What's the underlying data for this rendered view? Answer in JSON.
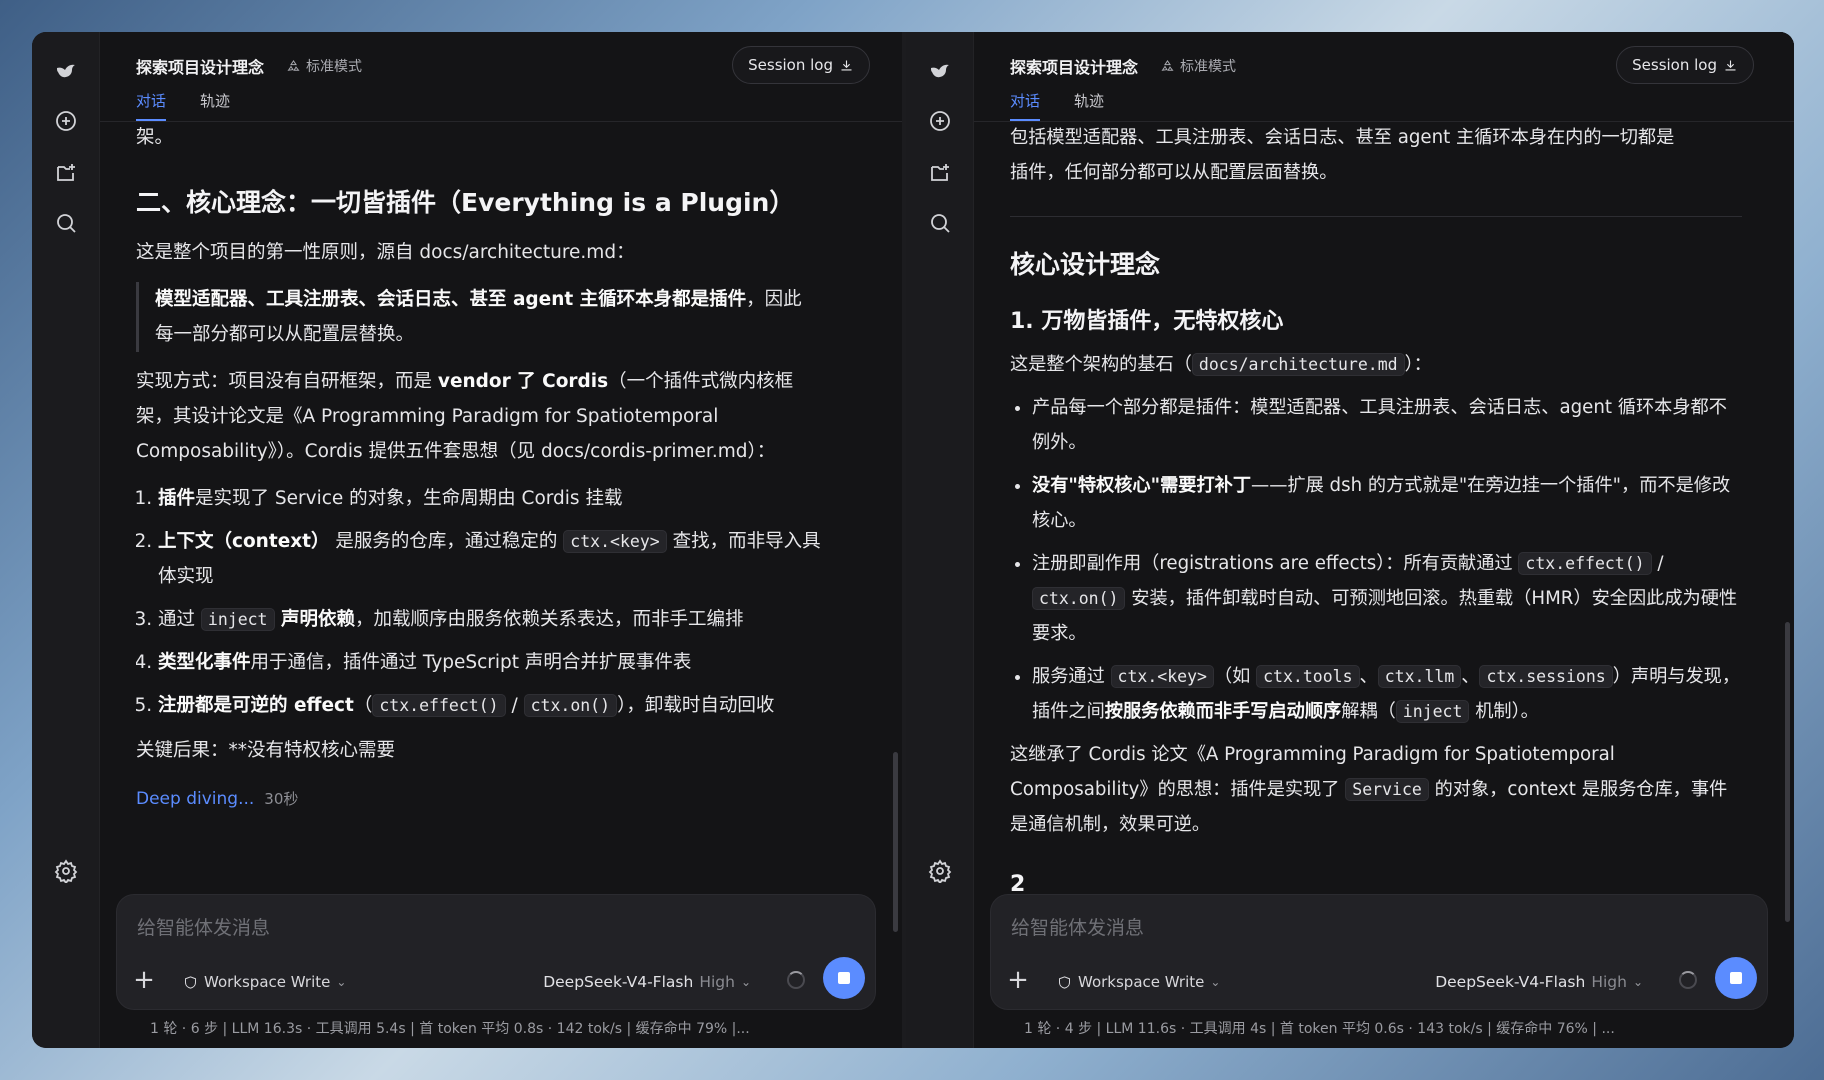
{
  "left": {
    "title": "探索项目设计理念",
    "mode": "标准模式",
    "session_log": "Session log",
    "tabs": [
      "对话",
      "轨迹"
    ],
    "content": {
      "frag": "架。",
      "h2": "二、核心理念：一切皆插件（Everything is a Plugin）",
      "p1": "这是整个项目的第一性原则，源自 docs/architecture.md：",
      "quote_bold": "模型适配器、工具注册表、会话日志、甚至 agent 主循环本身都是插件",
      "quote_rest_a": "，因此",
      "quote_rest_b": "每一部分都可以从配置层替换。",
      "p2a": "实现方式：项目没有自研框架，而是 ",
      "p2b": "vendor 了 Cordis",
      "p2c": "（一个插件式微内核框",
      "p2d": "架，其设计论文是《A Programming Paradigm for Spatiotemporal",
      "p2e": "Composability》）。Cordis 提供五件套思想（见 docs/cordis-primer.md）：",
      "items": [
        {
          "b": "插件",
          "t": "是实现了 Service 的对象，生命周期由 Cordis 挂载"
        },
        {
          "b": "上下文（context）",
          "t1": " 是服务的仓库，通过稳定的 ",
          "code": "ctx.<key>",
          "t2": " 查找，而非导入具",
          "t3": "体实现"
        },
        {
          "t1": "通过 ",
          "code": "inject",
          "b": " 声明依赖",
          "t2": "，加载顺序由服务依赖关系表达，而非手工编排"
        },
        {
          "b": "类型化事件",
          "t": "用于通信，插件通过 TypeScript 声明合并扩展事件表"
        },
        {
          "b": "注册都是可逆的 effect",
          "t1": "（",
          "code1": "ctx.effect()",
          "sep": " / ",
          "code2": "ctx.on()",
          "t2": "），卸载时自动回收"
        }
      ],
      "p3": "关键后果：**没有特权核心需要",
      "deep": "Deep diving...",
      "deep_time": "30秒"
    },
    "composer": {
      "placeholder": "给智能体发消息",
      "workspace": "Workspace Write",
      "model": "DeepSeek-V4-Flash",
      "level": "High"
    },
    "stats": "1 轮 · 6 步  |  LLM 16.3s · 工具调用 5.4s  |  首 token 平均 0.8s · 142 tok/s  |  缓存命中 79%  |..."
  },
  "right": {
    "title": "探索项目设计理念",
    "mode": "标准模式",
    "session_log": "Session log",
    "tabs": [
      "对话",
      "轨迹"
    ],
    "content": {
      "top1": "包括模型适配器、工具注册表、会话日志、甚至 agent 主循环本身在内的一切都是",
      "top2": "插件，任何部分都可以从配置层面替换。",
      "h2": "核心设计理念",
      "h3": "1. 万物皆插件，无特权核心",
      "p1a": "这是整个架构的基石（",
      "p1code": "docs/architecture.md",
      "p1b": "）：",
      "b1": "产品每一个部分都是插件：模型适配器、工具注册表、会话日志、agent 循环本身都不例外。",
      "b2bold": "没有\"特权核心\"需要打补丁",
      "b2rest": "——扩展 dsh 的方式就是\"在旁边挂一个插件\"，而不是修改核心。",
      "b3a": "注册即副作用（registrations are effects）：所有贡献通过 ",
      "b3c1": "ctx.effect()",
      "b3s": " / ",
      "b3c2": "ctx.on()",
      "b3b": " 安装，插件卸载时自动、可预测地回滚。热重载（HMR）安全因此成为硬性要求。",
      "b4a": "服务通过 ",
      "b4c1": "ctx.<key>",
      "b4b": "（如 ",
      "b4c2": "ctx.tools",
      "b4c3": "ctx.llm",
      "b4c4": "ctx.sessions",
      "b4d": "）声明与发现，插件之间",
      "b4bold": "按服务依赖而非手写启动顺序",
      "b4e": "解耦（",
      "b4c5": "inject",
      "b4f": " 机制）。",
      "p2a": "这继承了 Cordis 论文《A Programming Paradigm for Spatiotemporal Composability》的思想：插件是实现了 ",
      "p2code": "Service",
      "p2b": " 的对象，context 是服务仓库，事件是通信机制，效果可逆。",
      "h_next": "2"
    },
    "composer": {
      "placeholder": "给智能体发消息",
      "workspace": "Workspace Write",
      "model": "DeepSeek-V4-Flash",
      "level": "High"
    },
    "stats": "1 轮 · 4 步  |  LLM 11.6s · 工具调用 4s  |  首 token 平均 0.6s · 143 tok/s  |  缓存命中 76%  |  ..."
  },
  "icons": [
    "logo-icon",
    "new-chat-icon",
    "new-folder-icon",
    "search-icon",
    "settings-icon"
  ],
  "accent": "#5b8cff"
}
